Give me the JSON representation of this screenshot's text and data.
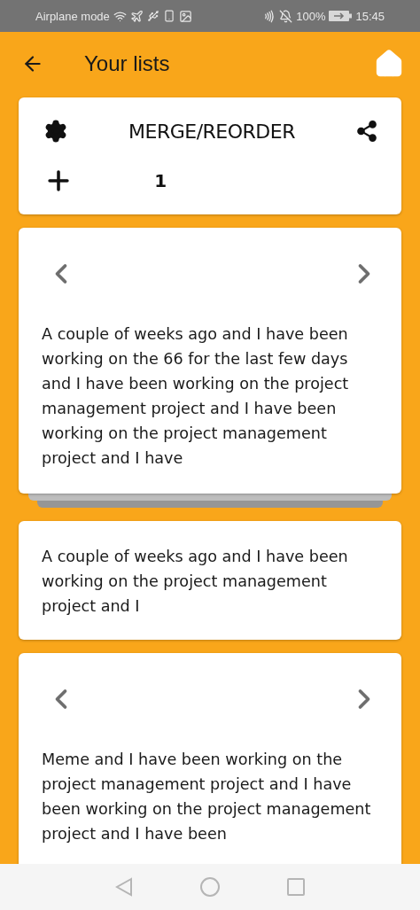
{
  "status_bar": {
    "left_text": "Airplane mode",
    "battery": "100%",
    "time": "15:45"
  },
  "header": {
    "title": "Your lists"
  },
  "toolbar_card": {
    "title": "MERGE/REORDER",
    "count": "1"
  },
  "cards": [
    {
      "kind": "carousel",
      "stacked": true,
      "text": "A couple of weeks ago and I have been working on the 66 for the last few days and I have been working on the project management project and I have been working on the project management project and I have"
    },
    {
      "kind": "plain",
      "stacked": false,
      "text": "A couple of weeks ago and I have been working on the project management project and I"
    },
    {
      "kind": "carousel",
      "stacked": false,
      "text": "Meme and I have been working on the project management project and I have been working on the project management project and I have been"
    }
  ]
}
